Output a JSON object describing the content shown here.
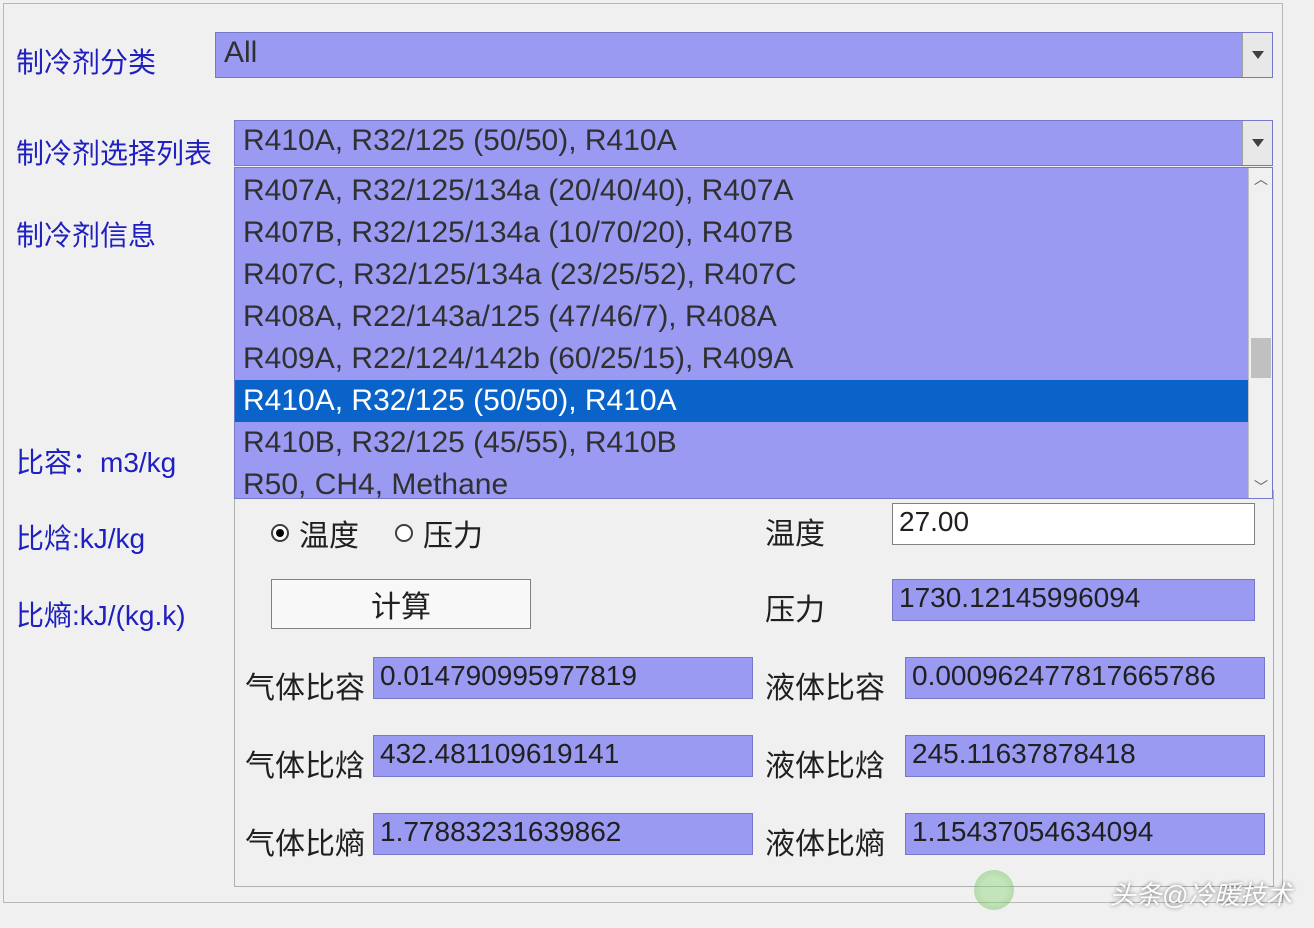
{
  "labels": {
    "category": "制冷剂分类",
    "select_list": "制冷剂选择列表",
    "info": "制冷剂信息",
    "specific_volume": "比容：m3/kg",
    "specific_enthalpy": "比焓:kJ/kg",
    "specific_entropy": "比熵:kJ/(kg.k)"
  },
  "category_combo": {
    "value": "All"
  },
  "select_combo": {
    "value": "R410A, R32/125 (50/50), R410A"
  },
  "dropdown": {
    "items": [
      "R407A, R32/125/134a (20/40/40), R407A",
      "R407B, R32/125/134a (10/70/20), R407B",
      "R407C, R32/125/134a (23/25/52), R407C",
      "R408A, R22/143a/125 (47/46/7), R408A",
      "R409A, R22/124/142b (60/25/15), R409A",
      "R410A, R32/125 (50/50), R410A",
      "R410B, R32/125 (45/55), R410B",
      "R50, CH4, Methane"
    ],
    "selected_index": 5
  },
  "calc": {
    "radio_temperature": "温度",
    "radio_pressure": "压力",
    "radio_selected": "temperature",
    "button": "计算",
    "lbl_temperature": "温度",
    "lbl_pressure": "压力",
    "val_temperature": "27.00",
    "val_pressure": "1730.12145996094",
    "lbl_gas_volume": "气体比容",
    "val_gas_volume": "0.014790995977819",
    "lbl_liq_volume": "液体比容",
    "val_liq_volume": "0.000962477817665786",
    "lbl_gas_enthalpy": "气体比焓",
    "val_gas_enthalpy": "432.481109619141",
    "lbl_liq_enthalpy": "液体比焓",
    "val_liq_enthalpy": "245.11637878418",
    "lbl_gas_entropy": "气体比熵",
    "val_gas_entropy": "1.77883231639862",
    "lbl_liq_entropy": "液体比熵",
    "val_liq_entropy": "1.15437054634094"
  },
  "watermark": "头条@冷暖技术"
}
